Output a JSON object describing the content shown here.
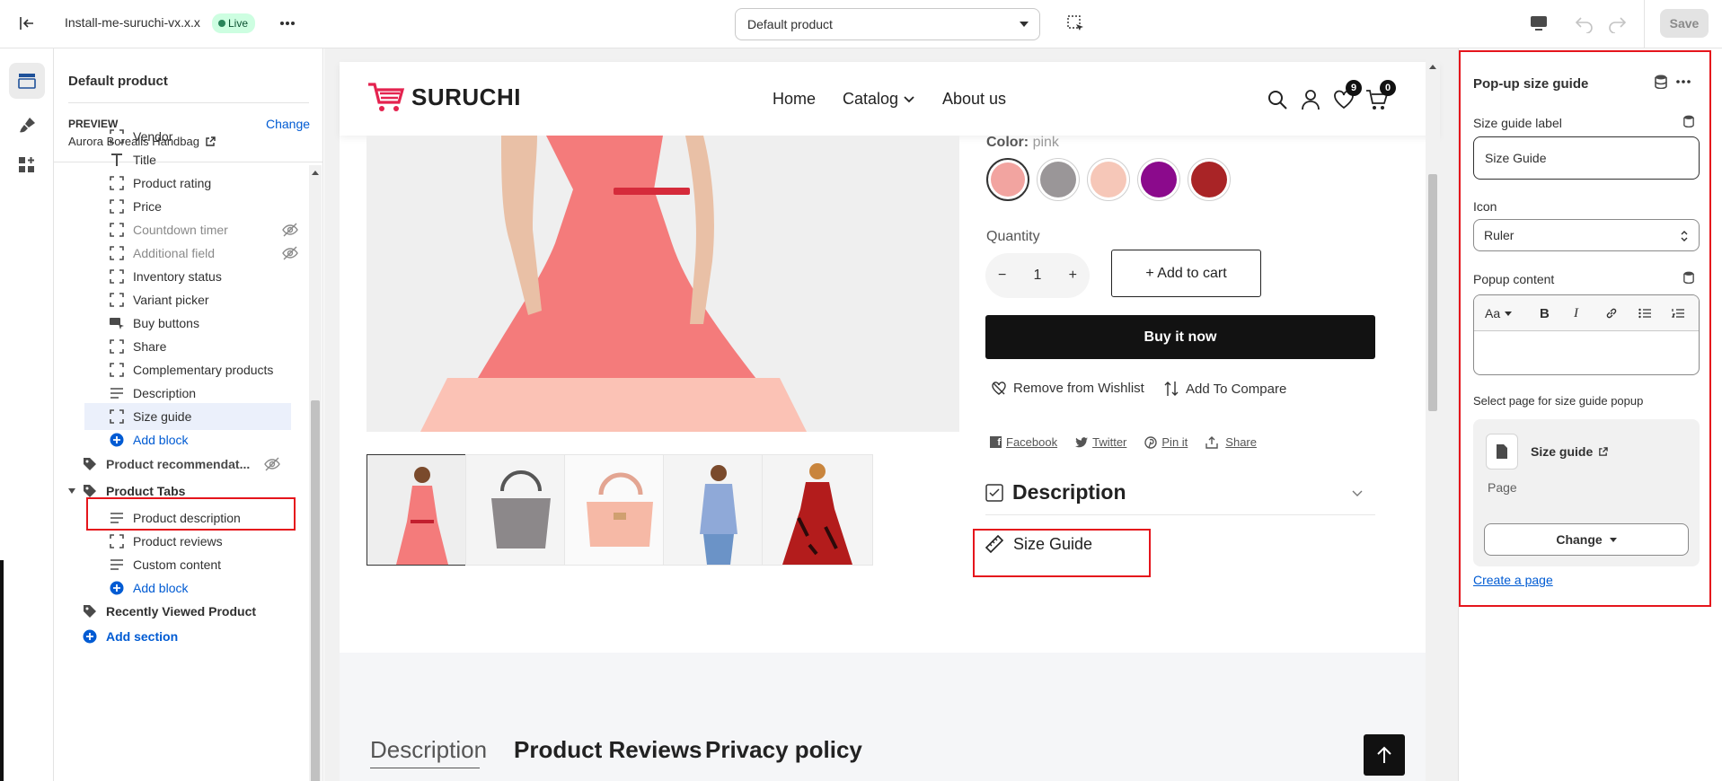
{
  "topbar": {
    "theme_name": "Install-me-suruchi-vx.x.x",
    "live_badge": "Live",
    "template_select": "Default product",
    "save_label": "Save"
  },
  "sidebar": {
    "title": "Default product",
    "preview_label": "PREVIEW",
    "change_label": "Change",
    "preview_product": "Aurora Borealis Handbag",
    "items": [
      {
        "label": "Vendor",
        "icon": "block-icon"
      },
      {
        "label": "Title",
        "icon": "text-icon"
      },
      {
        "label": "Product rating",
        "icon": "block-icon"
      },
      {
        "label": "Price",
        "icon": "block-icon"
      },
      {
        "label": "Countdown timer",
        "icon": "block-icon",
        "hidden": true
      },
      {
        "label": "Additional field",
        "icon": "block-icon",
        "hidden": true
      },
      {
        "label": "Inventory status",
        "icon": "block-icon"
      },
      {
        "label": "Variant picker",
        "icon": "block-icon"
      },
      {
        "label": "Buy buttons",
        "icon": "buy-buttons-icon"
      },
      {
        "label": "Share",
        "icon": "block-icon"
      },
      {
        "label": "Complementary products",
        "icon": "block-icon"
      },
      {
        "label": "Description",
        "icon": "lines-icon"
      },
      {
        "label": "Size guide",
        "icon": "block-icon",
        "selected": true
      },
      {
        "label": "Add block",
        "icon": "plus-circle-icon"
      }
    ],
    "sections": [
      {
        "label": "Product recommendat...",
        "hidden": true
      },
      {
        "label": "Product Tabs"
      },
      {
        "label": "Recently Viewed Product"
      },
      {
        "label": "Add section"
      }
    ],
    "tab_items": [
      {
        "label": "Product description",
        "icon": "lines-icon"
      },
      {
        "label": "Product reviews",
        "icon": "block-icon"
      },
      {
        "label": "Custom content",
        "icon": "lines-icon"
      },
      {
        "label": "Add block",
        "icon": "plus-circle-icon"
      }
    ]
  },
  "store": {
    "logo_text": "SURUCHI",
    "nav": [
      "Home",
      "Catalog",
      "About us"
    ],
    "wishlist_count": "9",
    "cart_count": "0",
    "color_label": "Color:",
    "color_value": "pink",
    "swatch_colors": [
      "#f2a4a0",
      "#9a9698",
      "#f6c7b8",
      "#8b0a8c",
      "#a92426"
    ],
    "quantity_label": "Quantity",
    "quantity_value": "1",
    "add_to_cart": "+ Add to cart",
    "buy_now": "Buy it now",
    "remove_wishlist": "Remove from Wishlist",
    "add_compare": "Add To Compare",
    "share_links": [
      "Facebook",
      "Twitter",
      "Pin it",
      "Share"
    ],
    "description_heading": "Description",
    "size_guide_link": "Size Guide",
    "tabs": [
      "Description",
      "Product Reviews",
      "Privacy policy"
    ]
  },
  "settings": {
    "title": "Pop-up size guide",
    "size_label_title": "Size guide label",
    "size_label_value": "Size Guide",
    "icon_title": "Icon",
    "icon_value": "Ruler",
    "popup_content_title": "Popup content",
    "select_page_title": "Select page for size guide popup",
    "page_name": "Size guide",
    "page_type": "Page",
    "change_button": "Change",
    "create_page": "Create a page"
  }
}
